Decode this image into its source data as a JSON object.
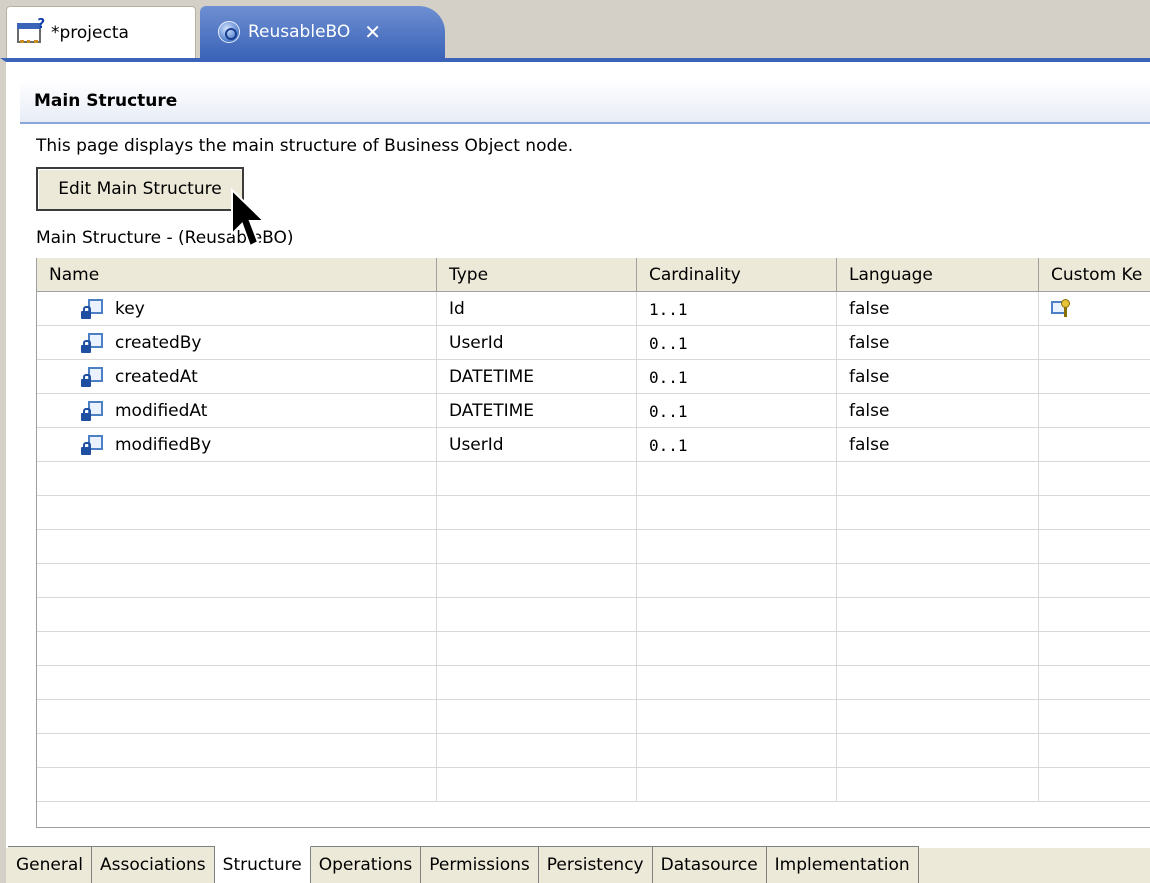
{
  "tabs": [
    {
      "label": "*projecta",
      "icon": "project-icon",
      "active": false
    },
    {
      "label": "ReusableBO",
      "icon": "business-object-icon",
      "active": true
    }
  ],
  "section": {
    "title": "Main Structure",
    "description": "This page displays the main structure of Business Object node.",
    "edit_button": "Edit Main Structure",
    "table_caption": "Main Structure - (ReusableBO)"
  },
  "table": {
    "columns": [
      "Name",
      "Type",
      "Cardinality",
      "Language",
      "Custom Ke"
    ],
    "rows": [
      {
        "name": "key",
        "type": "Id",
        "cardinality": "1..1",
        "language": "false",
        "custom_key": true
      },
      {
        "name": "createdBy",
        "type": "UserId",
        "cardinality": "0..1",
        "language": "false",
        "custom_key": false
      },
      {
        "name": "createdAt",
        "type": "DATETIME",
        "cardinality": "0..1",
        "language": "false",
        "custom_key": false
      },
      {
        "name": "modifiedAt",
        "type": "DATETIME",
        "cardinality": "0..1",
        "language": "false",
        "custom_key": false
      },
      {
        "name": "modifiedBy",
        "type": "UserId",
        "cardinality": "0..1",
        "language": "false",
        "custom_key": false
      }
    ]
  },
  "page_tabs": [
    {
      "label": "General",
      "active": false
    },
    {
      "label": "Associations",
      "active": false
    },
    {
      "label": "Structure",
      "active": true
    },
    {
      "label": "Operations",
      "active": false
    },
    {
      "label": "Permissions",
      "active": false
    },
    {
      "label": "Persistency",
      "active": false
    },
    {
      "label": "Datasource",
      "active": false
    },
    {
      "label": "Implementation",
      "active": false
    }
  ],
  "colors": {
    "accent": "#3b64b8",
    "header_bg": "#ece9d8"
  }
}
